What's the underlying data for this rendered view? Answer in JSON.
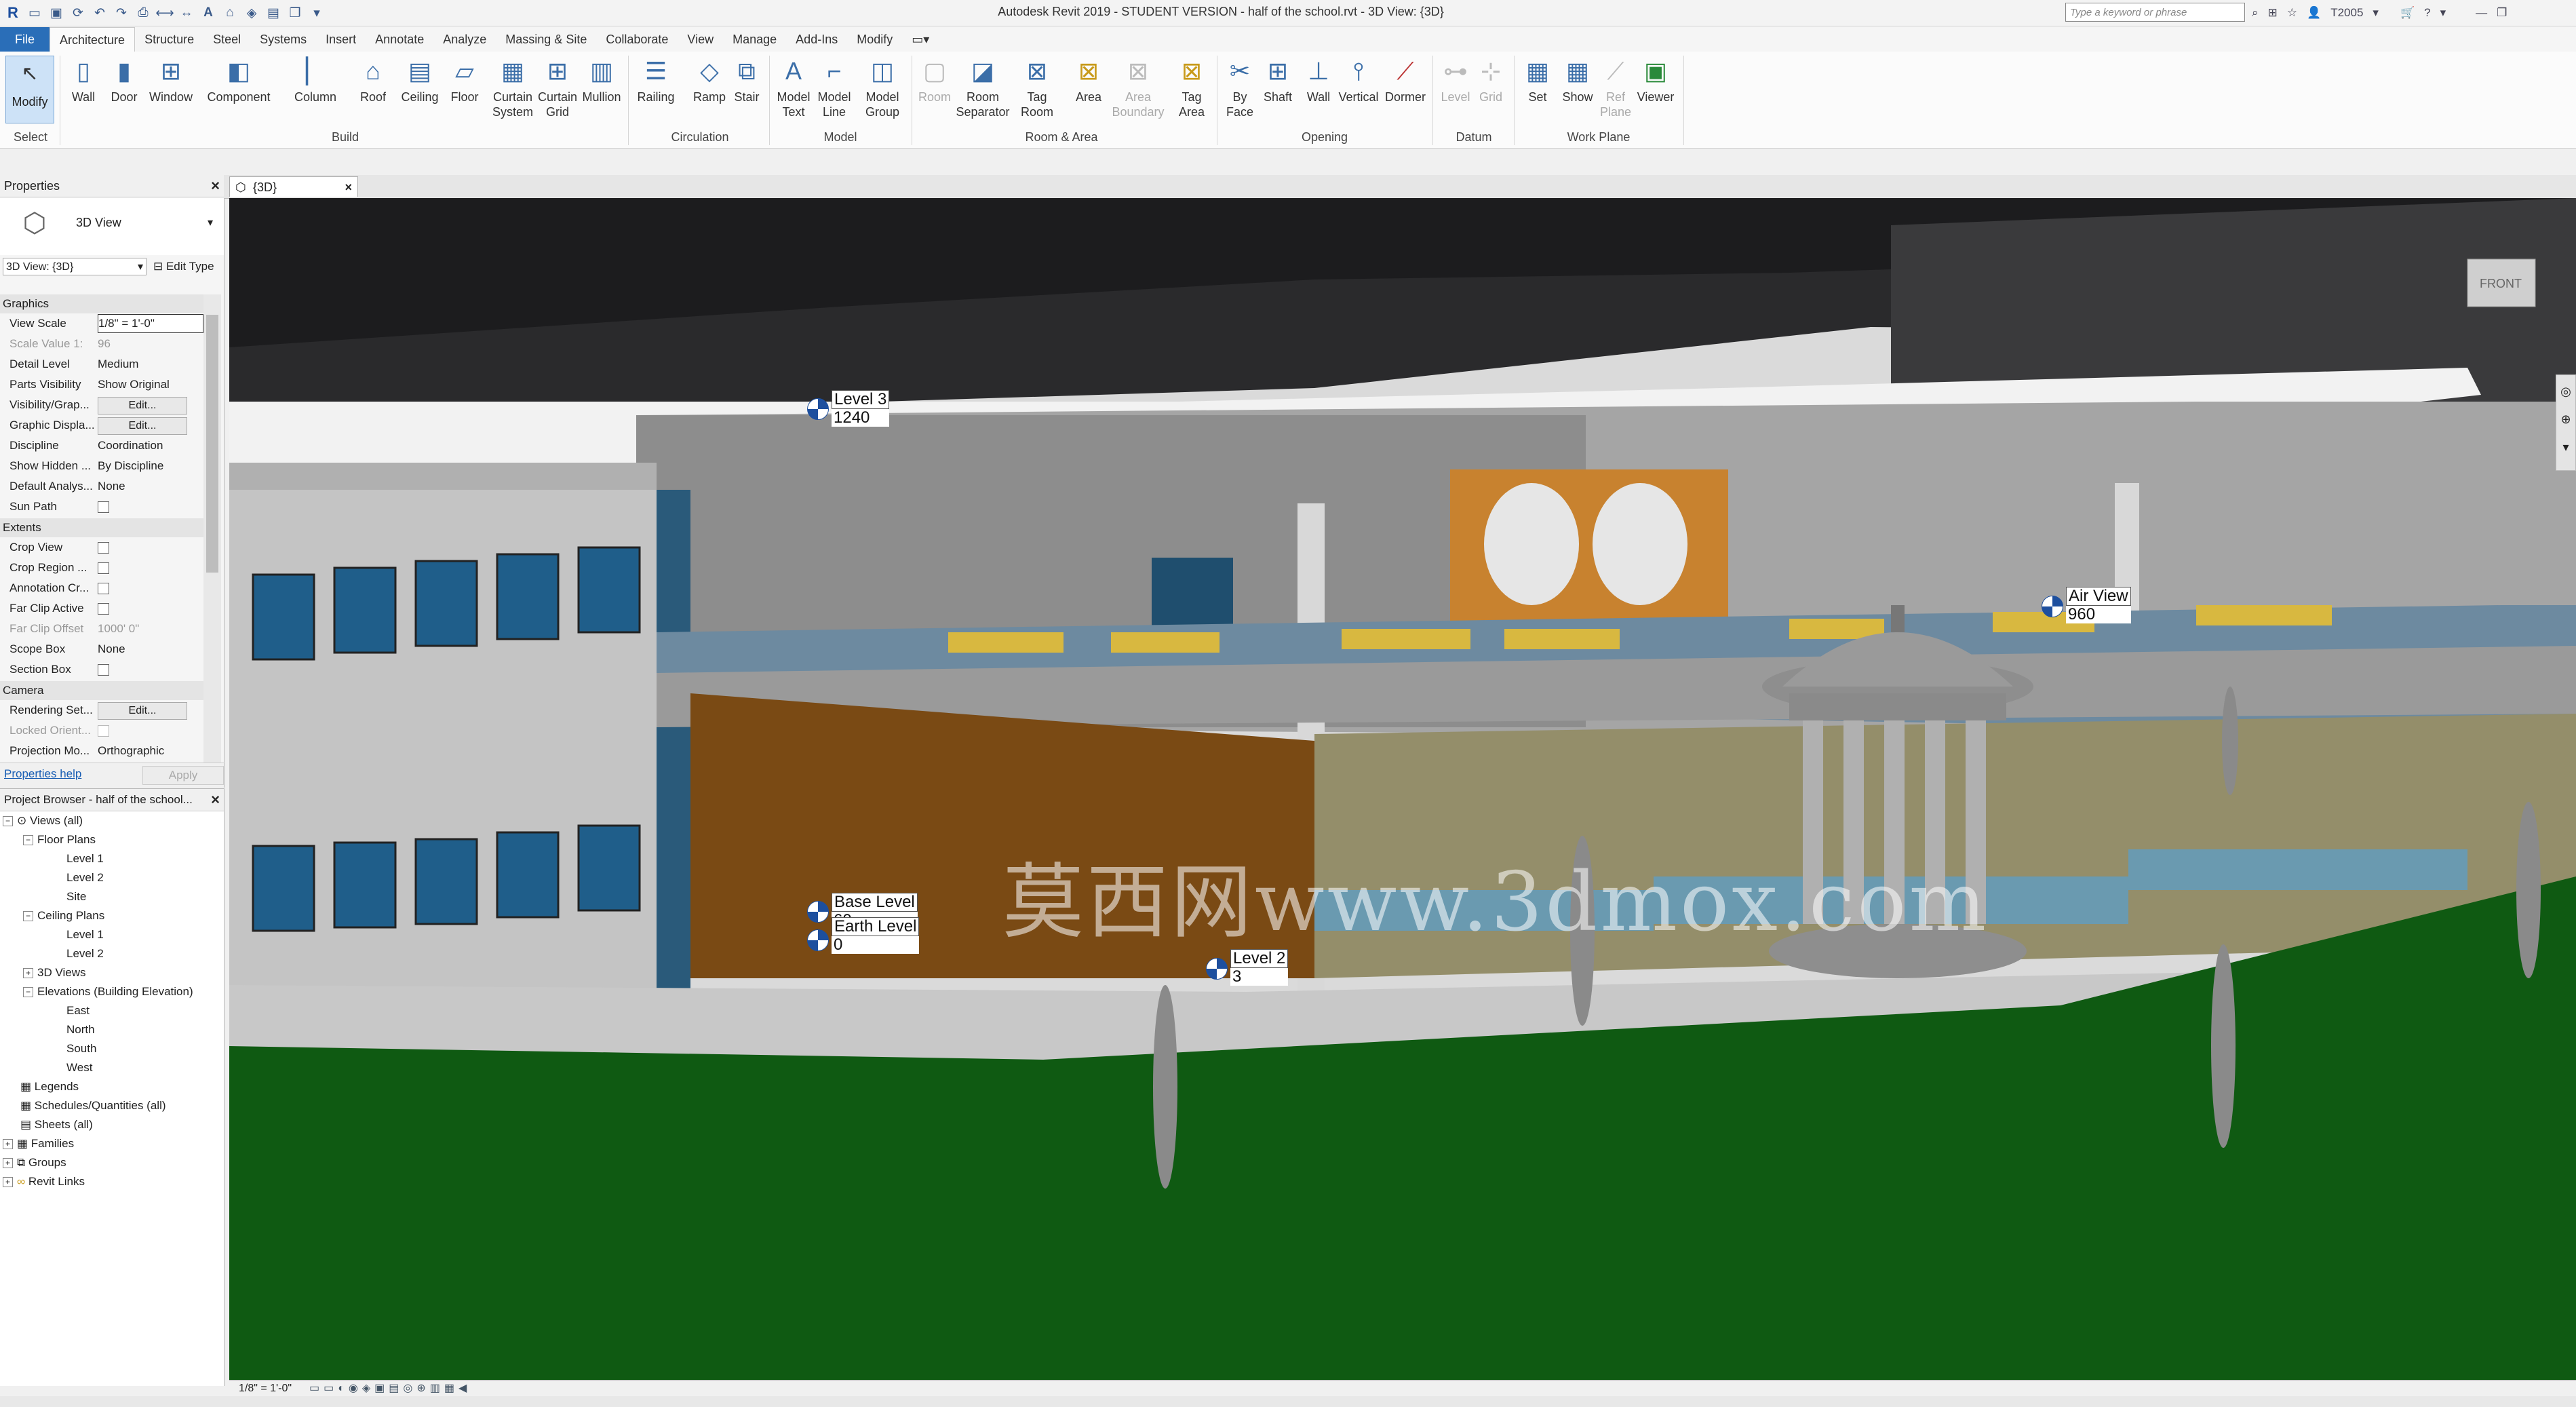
{
  "titlebar": {
    "app_title": "Autodesk Revit 2019 - STUDENT VERSION - half of the school.rvt - 3D View: {3D}",
    "search_placeholder": "Type a keyword or phrase",
    "user": "T2005"
  },
  "ribbon_tabs": [
    "File",
    "Architecture",
    "Structure",
    "Steel",
    "Systems",
    "Insert",
    "Annotate",
    "Analyze",
    "Massing & Site",
    "Collaborate",
    "View",
    "Manage",
    "Add-Ins",
    "Modify"
  ],
  "ribbon": {
    "select": {
      "modify": "Modify",
      "group": "Select"
    },
    "build": {
      "wall": "Wall",
      "door": "Door",
      "window": "Window",
      "component": "Component",
      "column": "Column",
      "roof": "Roof",
      "ceiling": "Ceiling",
      "floor": "Floor",
      "curtain_system": "Curtain System",
      "curtain_grid": "Curtain Grid",
      "mullion": "Mullion",
      "group": "Build"
    },
    "circulation": {
      "railing": "Railing",
      "ramp": "Ramp",
      "stair": "Stair",
      "group": "Circulation"
    },
    "model": {
      "model_text": "Model Text",
      "model_line": "Model Line",
      "model_group": "Model Group",
      "group": "Model"
    },
    "room_area": {
      "room": "Room",
      "room_separator": "Room Separator",
      "tag_room": "Tag Room",
      "area": "Area",
      "area_boundary": "Area Boundary",
      "tag_area": "Tag Area",
      "group": "Room & Area"
    },
    "opening": {
      "by_face": "By Face",
      "shaft": "Shaft",
      "wall": "Wall",
      "vertical": "Vertical",
      "dormer": "Dormer",
      "group": "Opening"
    },
    "datum": {
      "level": "Level",
      "grid": "Grid",
      "group": "Datum"
    },
    "work_plane": {
      "set": "Set",
      "show": "Show",
      "ref_plane": "Ref Plane",
      "viewer": "Viewer",
      "group": "Work Plane"
    }
  },
  "properties": {
    "title": "Properties",
    "type_name": "3D View",
    "instance_selector": "3D View: {3D}",
    "edit_type": "Edit Type",
    "groups": {
      "graphics": "Graphics",
      "extents": "Extents",
      "camera": "Camera"
    },
    "graphics_rows": [
      {
        "key": "View Scale",
        "value": "1/8\" = 1'-0\""
      },
      {
        "key": "Scale Value    1:",
        "value": "96"
      },
      {
        "key": "Detail Level",
        "value": "Medium"
      },
      {
        "key": "Parts Visibility",
        "value": "Show Original"
      },
      {
        "key": "Visibility/Grap...",
        "value": "Edit..."
      },
      {
        "key": "Graphic Displa...",
        "value": "Edit..."
      },
      {
        "key": "Discipline",
        "value": "Coordination"
      },
      {
        "key": "Show Hidden ...",
        "value": "By Discipline"
      },
      {
        "key": "Default Analys...",
        "value": "None"
      },
      {
        "key": "Sun Path",
        "value": ""
      }
    ],
    "extents_rows": [
      {
        "key": "Crop View",
        "value": ""
      },
      {
        "key": "Crop Region ...",
        "value": ""
      },
      {
        "key": "Annotation Cr...",
        "value": ""
      },
      {
        "key": "Far Clip Active",
        "value": ""
      },
      {
        "key": "Far Clip Offset",
        "value": "1000'  0\""
      },
      {
        "key": "Scope Box",
        "value": "None"
      },
      {
        "key": "Section Box",
        "value": ""
      }
    ],
    "camera_rows": [
      {
        "key": "Rendering Set...",
        "value": "Edit..."
      },
      {
        "key": "Locked Orient...",
        "value": ""
      },
      {
        "key": "Projection Mo...",
        "value": "Orthographic"
      }
    ],
    "help": "Properties help",
    "apply": "Apply"
  },
  "browser": {
    "title": "Project Browser - half of the school...",
    "nodes": {
      "views_all": "Views (all)",
      "floor_plans": "Floor Plans",
      "fp_level1": "Level 1",
      "fp_level2": "Level 2",
      "fp_site": "Site",
      "ceiling_plans": "Ceiling Plans",
      "cp_level1": "Level 1",
      "cp_level2": "Level 2",
      "views_3d": "3D Views",
      "elevations": "Elevations (Building Elevation)",
      "east": "East",
      "north": "North",
      "south": "South",
      "west": "West",
      "legends": "Legends",
      "schedules": "Schedules/Quantities (all)",
      "sheets": "Sheets (all)",
      "families": "Families",
      "groups": "Groups",
      "revit_links": "Revit Links"
    }
  },
  "view_tab": {
    "label": "{3D}"
  },
  "viewport": {
    "levels": {
      "level3": {
        "name": "Level 3",
        "value": "1240"
      },
      "air_view": {
        "name": "Air View",
        "value": "960"
      },
      "base_level": {
        "name": "Base Level",
        "value": "60"
      },
      "earth_level": {
        "name": "Earth Level",
        "value": "0"
      },
      "level2": {
        "name": "Level 2",
        "value": "3"
      }
    },
    "viewcube_label": "FRONT",
    "watermark": "莫西网www.3dmox.com"
  },
  "view_control_bar": {
    "scale": "1/8\" = 1'-0\""
  },
  "colors": {
    "file_tab": "#2a6eb8",
    "grass": "#0f5a12",
    "roof_dark": "#1c1c1e",
    "mural": "#c8822f"
  }
}
